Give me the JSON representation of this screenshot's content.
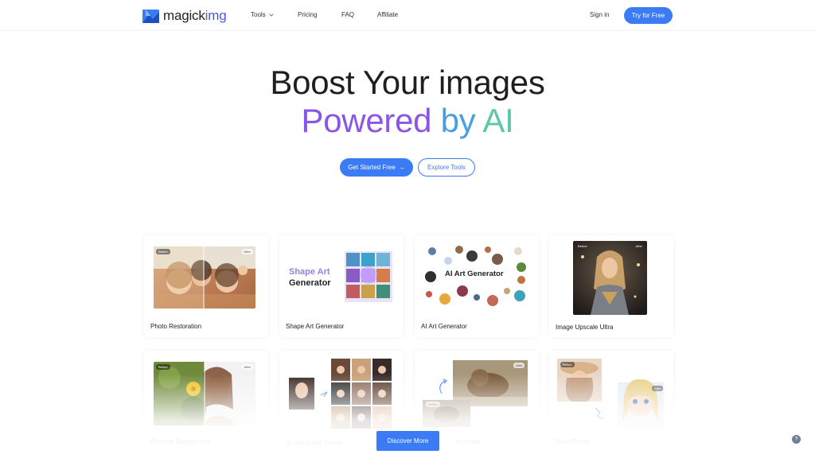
{
  "header": {
    "logo_text_main": "magick",
    "logo_text_accent": "img",
    "nav": {
      "tools": "Tools",
      "pricing": "Pricing",
      "faq": "FAQ",
      "affiliate": "Affiliate"
    },
    "sign_in": "Sign in",
    "try_free": "Try for Free"
  },
  "hero": {
    "line1": "Boost Your images",
    "line2_part1": "Powered",
    "line2_part2": "by",
    "line2_part3": "AI",
    "cta_primary": "Get Started Free",
    "cta_primary_arrow": "→",
    "cta_secondary": "Explore Tools"
  },
  "tools": [
    {
      "label": "Photo Restoration",
      "before": "Before",
      "after": "After"
    },
    {
      "label": "Shape Art Generator",
      "thumb_title_1": "Shape Art",
      "thumb_title_2": "Generator"
    },
    {
      "label": "AI Art Generator",
      "thumb_title": "AI Art Generator"
    },
    {
      "label": "Image Upscale Ultra",
      "before": "Before",
      "after": "After"
    },
    {
      "label": "Remove Background",
      "before": "Before",
      "after": "After"
    },
    {
      "label": "AI Hair Color Try-on"
    },
    {
      "label": "le Image",
      "before": "Before",
      "after": "After"
    },
    {
      "label": "Face2Emoji",
      "before": "Before",
      "after": "After"
    }
  ],
  "discover_more": "Discover More",
  "help_icon": "?",
  "colors": {
    "accent": "#3b7cf6",
    "gradient_purple": "#8a56e8",
    "gradient_blue": "#4a9fe0",
    "gradient_teal": "#5ec7a4"
  }
}
